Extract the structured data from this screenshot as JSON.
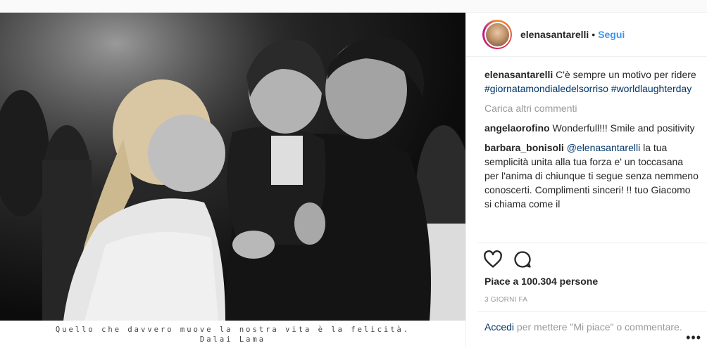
{
  "photo": {
    "caption_line1": "Quello che davvero muove la nostra vita è la felicità.",
    "caption_line2": "Dalai Lama"
  },
  "header": {
    "username": "elenasantarelli",
    "separator": "•",
    "follow_label": "Segui"
  },
  "post": {
    "author": "elenasantarelli",
    "text": "C'è sempre un motivo per ridere",
    "hashtag1": "#giornatamondialedelsorriso",
    "hashtag2": "#worldlaughterday"
  },
  "load_more_label": "Carica altri commenti",
  "comments": [
    {
      "user": "angelaorofino",
      "text": "Wonderfull!!! Smile and positivity"
    },
    {
      "user": "barbara_bonisoli",
      "mention": "@elenasantarelli",
      "text": "la tua semplicità unita alla tua forza e' un toccasana per l'anima di chiunque ti segue senza nemmeno conoscerti. Complimenti sinceri! !! tuo Giacomo si chiama come il"
    }
  ],
  "actions": {
    "like_icon": "heart-icon",
    "comment_icon": "comment-icon"
  },
  "likes_text": "Piace a 100.304 persone",
  "timestamp": "3 GIORNI FA",
  "login": {
    "link": "Accedi",
    "text": "per mettere \"Mi piace\" o commentare."
  },
  "more_options": "•••"
}
